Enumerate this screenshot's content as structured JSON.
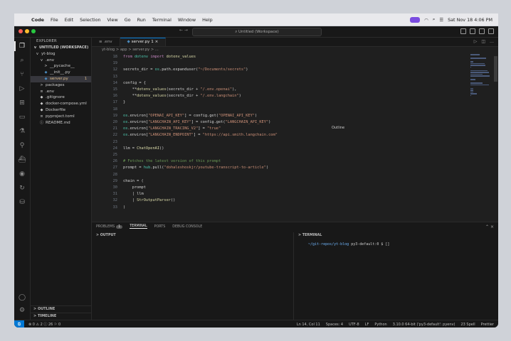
{
  "menubar": {
    "app": "Code",
    "items": [
      "File",
      "Edit",
      "Selection",
      "View",
      "Go",
      "Run",
      "Terminal",
      "Window",
      "Help"
    ],
    "datetime": "Sat Nov 18  4:06 PM"
  },
  "titlebar": {
    "search": "Untitled (Workspace)"
  },
  "sidebar": {
    "header": "EXPLORER",
    "workspace": "UNTITLED (WORKSPACE)",
    "tree": [
      {
        "label": "yt-blog",
        "indent": 1,
        "icon": "v"
      },
      {
        "label": ".env",
        "indent": 2,
        "icon": "v"
      },
      {
        "label": "__pycache__",
        "indent": 3,
        "icon": ">"
      },
      {
        "label": "__init__.py",
        "indent": 3,
        "icon": "py"
      },
      {
        "label": "server.py",
        "indent": 3,
        "icon": "py",
        "badge": "1",
        "selected": true
      },
      {
        "label": "packages",
        "indent": 2,
        "icon": ">"
      },
      {
        "label": ".env",
        "indent": 2,
        "icon": "≡"
      },
      {
        "label": ".gitignore",
        "indent": 2,
        "icon": "◆"
      },
      {
        "label": "docker-compose.yml",
        "indent": 2,
        "icon": "◆"
      },
      {
        "label": "Dockerfile",
        "indent": 2,
        "icon": "◆"
      },
      {
        "label": "pyproject.toml",
        "indent": 2,
        "icon": "≡"
      },
      {
        "label": "README.md",
        "indent": 2,
        "icon": "ⓘ"
      }
    ],
    "outline": "OUTLINE",
    "timeline": "TIMELINE"
  },
  "tabs": [
    {
      "label": ".env",
      "active": false
    },
    {
      "label": "server.py 1",
      "active": true
    }
  ],
  "breadcrumb": "yt-blog  >  app  >  server.py  >  ...",
  "code": [
    {
      "n": "18",
      "text": "from dotenv import dotenv_values"
    },
    {
      "n": "19",
      "text": ""
    },
    {
      "n": "12",
      "text": "secrets_dir = os.path.expanduser(\"~/Documents/secrets\")"
    },
    {
      "n": "13",
      "text": ""
    },
    {
      "n": "14",
      "text": "config = {"
    },
    {
      "n": "15",
      "text": "    **dotenv_values(secrets_dir + \"/.env.openai\"),"
    },
    {
      "n": "16",
      "text": "    **dotenv_values(secrets_dir + \"/.env.langchain\")"
    },
    {
      "n": "17",
      "text": "}"
    },
    {
      "n": "18",
      "text": ""
    },
    {
      "n": "19",
      "text": "os.environ[\"OPENAI_API_KEY\"] = config.get(\"OPENAI_API_KEY\")"
    },
    {
      "n": "20",
      "text": "os.environ[\"LANGCHAIN_API_KEY\"] = config.get(\"LANGCHAIN_API_KEY\")"
    },
    {
      "n": "21",
      "text": "os.environ[\"LANGCHAIN_TRACING_V2\"] = \"true\""
    },
    {
      "n": "22",
      "text": "os.environ[\"LANGCHAIN_ENDPOINT\"] = \"https://api.smith.langchain.com\""
    },
    {
      "n": "23",
      "text": ""
    },
    {
      "n": "24",
      "text": "llm = ChatOpenAI()"
    },
    {
      "n": "25",
      "text": ""
    },
    {
      "n": "26",
      "text": "# Fetches the latest version of this prompt"
    },
    {
      "n": "27",
      "text": "prompt = hub.pull(\"dohaleshoskjr/youtube-transcript-to-article\")"
    },
    {
      "n": "28",
      "text": ""
    },
    {
      "n": "29",
      "text": "chain = ("
    },
    {
      "n": "30",
      "text": "    prompt"
    },
    {
      "n": "31",
      "text": "    | llm"
    },
    {
      "n": "32",
      "text": "    | StrOutputParser()"
    },
    {
      "n": "33",
      "text": ")"
    }
  ],
  "outline_popup": "Outline",
  "panel": {
    "tabs": [
      {
        "label": "PROBLEMS",
        "count": "1"
      },
      {
        "label": "TERMINAL",
        "active": true
      },
      {
        "label": "PORTS"
      },
      {
        "label": "DEBUG CONSOLE"
      }
    ],
    "output_title": "OUTPUT",
    "terminal_title": "TERMINAL",
    "terminal_path": "~/git-repos/yt-blog",
    "terminal_rest": " py3-default:0 $ []"
  },
  "status": {
    "left": "⊗ 0 ⚠ 2 ⓘ 26   ⚐ 0",
    "right": [
      "Ln 14, Col 11",
      "Spaces: 4",
      "UTF-8",
      "LF",
      "Python",
      "3.10.0 64-bit ('py3-default': pyenv)",
      "23 Spell",
      "Prettier"
    ]
  }
}
